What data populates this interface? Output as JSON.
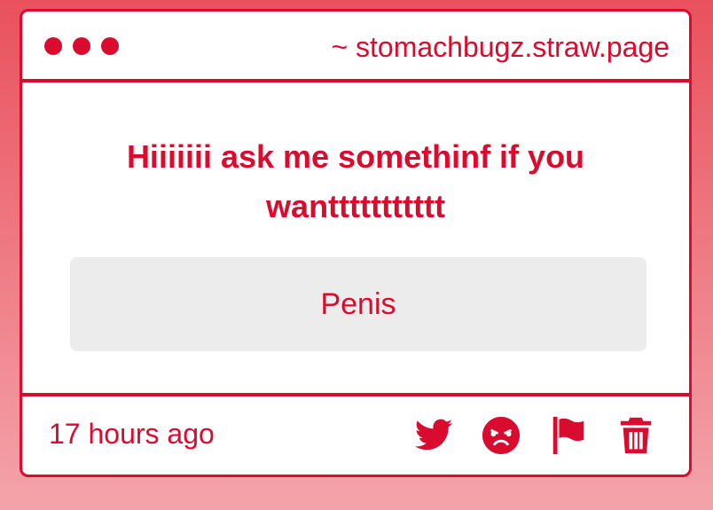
{
  "titlebar": {
    "url": "~ stomachbugz.straw.page"
  },
  "question": {
    "text": "Hiiiiiii ask me somethinf if you wanttttttttttt"
  },
  "answer": {
    "text": "Penis"
  },
  "footer": {
    "timestamp": "17 hours ago",
    "actions": [
      "twitter-icon",
      "angry-face-icon",
      "flag-icon",
      "trash-icon"
    ]
  },
  "colors": {
    "accent": "#d90b2e",
    "background_top": "#e9515d",
    "background_bottom": "#f4a3aa",
    "answer_bg": "#ececec"
  }
}
